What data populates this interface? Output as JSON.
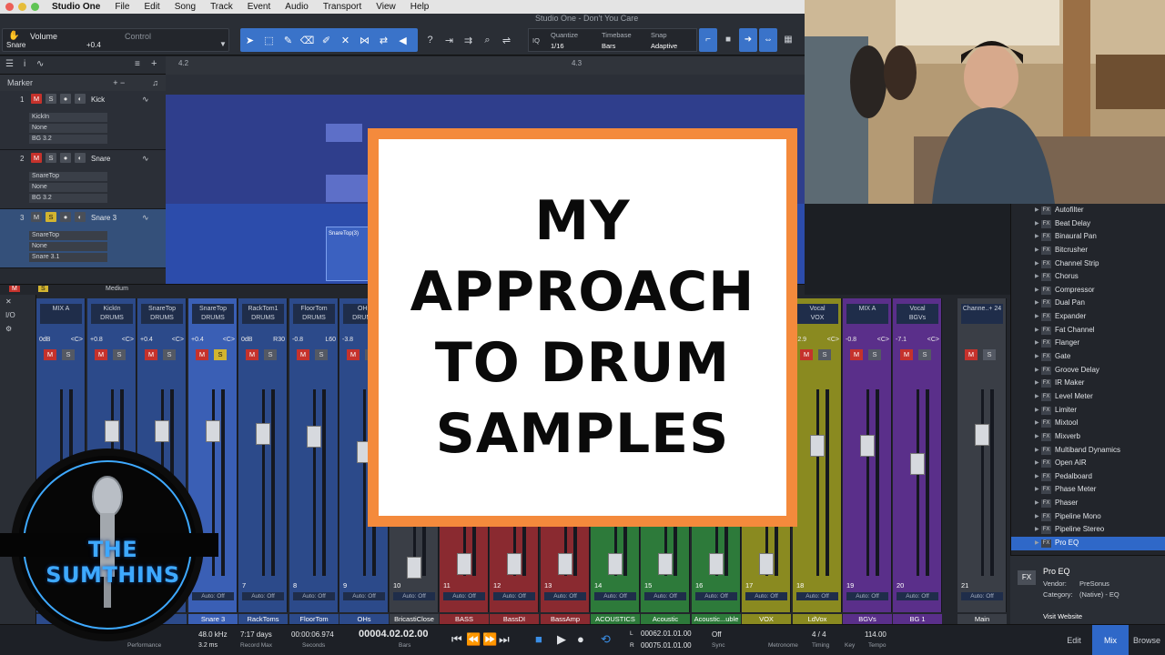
{
  "menubar": {
    "app": "Studio One",
    "items": [
      "File",
      "Edit",
      "Song",
      "Track",
      "Event",
      "Audio",
      "Transport",
      "View",
      "Help"
    ],
    "window_title": "Studio One - Don't You Care"
  },
  "toolbar": {
    "track_param": "Volume",
    "track_name": "Snare",
    "track_value": "+0.4",
    "control_label": "Control",
    "quantize_label": "Quantize",
    "quantize_value": "1/16",
    "timebase_label": "Timebase",
    "timebase_value": "Bars",
    "snap_label": "Snap",
    "snap_value": "Adaptive",
    "iq_label": "IQ"
  },
  "arrange": {
    "ruler_marks": [
      "4.2",
      "4.3"
    ],
    "marker_label": "Marker",
    "tracks": [
      {
        "num": "1",
        "name": "Kick",
        "input": "KickIn",
        "out": "None",
        "bus": "BG 3.2",
        "selected": false
      },
      {
        "num": "2",
        "name": "Snare",
        "input": "SnareTop",
        "out": "None",
        "bus": "BG 3.2",
        "selected": false
      },
      {
        "num": "3",
        "name": "Snare 3",
        "input": "SnareTop",
        "out": "None",
        "bus": "Snare 3.1",
        "selected": true
      }
    ],
    "clip_label": "SnareTop(3)",
    "size_label": "Medium"
  },
  "mixer": {
    "side": [
      "I/O"
    ],
    "strips": [
      {
        "top": "MIX A",
        "group": "",
        "vol": "0dB",
        "pan": "<C>",
        "num": "",
        "label": "",
        "color": "#2c4a8a"
      },
      {
        "top": "KickIn",
        "group": "DRUMS",
        "vol": "+0.8",
        "pan": "<C>",
        "num": "",
        "label": "",
        "color": "#2c4a8a"
      },
      {
        "top": "SnareTop",
        "group": "DRUMS",
        "vol": "+0.4",
        "pan": "<C>",
        "num": "",
        "label": "",
        "color": "#2c4a8a"
      },
      {
        "top": "SnareTop",
        "group": "DRUMS",
        "vol": "+0.4",
        "pan": "<C>",
        "num": "",
        "label": "Snare 3",
        "color": "#3a5fb5"
      },
      {
        "top": "RackTom1",
        "group": "DRUMS",
        "vol": "0dB",
        "pan": "R30",
        "num": "7",
        "label": "RackToms",
        "color": "#2c4a8a"
      },
      {
        "top": "FloorTom",
        "group": "DRUMS",
        "vol": "-0.8",
        "pan": "L60",
        "num": "8",
        "label": "FloorTom",
        "color": "#2c4a8a"
      },
      {
        "top": "OHs",
        "group": "DRUMS",
        "vol": "-3.8",
        "pan": "",
        "num": "9",
        "label": "OHs",
        "color": "#2c4a8a"
      },
      {
        "top": "",
        "group": "",
        "vol": "",
        "pan": "",
        "num": "10",
        "label": "BricastiClose",
        "color": "#3a3e46"
      },
      {
        "top": "",
        "group": "",
        "vol": "",
        "pan": "",
        "num": "11",
        "label": "BASS",
        "color": "#8a2a30"
      },
      {
        "top": "",
        "group": "",
        "vol": "",
        "pan": "",
        "num": "12",
        "label": "BassDI",
        "color": "#8a2a30"
      },
      {
        "top": "",
        "group": "",
        "vol": "",
        "pan": "",
        "num": "13",
        "label": "BassAmp",
        "color": "#8a2a30"
      },
      {
        "top": "",
        "group": "",
        "vol": "",
        "pan": "",
        "num": "14",
        "label": "ACOUSTICS",
        "color": "#2d7a3a"
      },
      {
        "top": "",
        "group": "",
        "vol": "",
        "pan": "",
        "num": "15",
        "label": "Acoustic",
        "color": "#2d7a3a"
      },
      {
        "top": "",
        "group": "",
        "vol": "",
        "pan": "",
        "num": "16",
        "label": "Acoustic...uble",
        "color": "#2d7a3a"
      },
      {
        "top": "",
        "group": "",
        "vol": "",
        "pan": "",
        "num": "17",
        "label": "VOX",
        "color": "#8a8a20"
      },
      {
        "top": "Vocal",
        "group": "VOX",
        "vol": "-2.9",
        "pan": "<C>",
        "num": "18",
        "label": "LdVox",
        "color": "#8a8a20"
      },
      {
        "top": "MIX A",
        "group": "",
        "vol": "-0.8",
        "pan": "<C>",
        "num": "19",
        "label": "BGVs",
        "color": "#5a2f8a"
      },
      {
        "top": "Vocal",
        "group": "BGVs",
        "vol": "-7.1",
        "pan": "<C>",
        "num": "20",
        "label": "BG 1",
        "color": "#5a2f8a"
      },
      {
        "top": "Channe..+ 24",
        "group": "",
        "vol": "",
        "pan": "",
        "num": "21",
        "label": "Main",
        "color": "#3a3e46"
      }
    ],
    "auto_label": "Auto: Off"
  },
  "browser": {
    "items": [
      "Autofilter",
      "Beat Delay",
      "Binaural Pan",
      "Bitcrusher",
      "Channel Strip",
      "Chorus",
      "Compressor",
      "Dual Pan",
      "Expander",
      "Fat Channel",
      "Flanger",
      "Gate",
      "Groove Delay",
      "IR Maker",
      "Level Meter",
      "Limiter",
      "Mixtool",
      "Mixverb",
      "Multiband Dynamics",
      "Open AIR",
      "Pedalboard",
      "Phase Meter",
      "Phaser",
      "Pipeline Mono",
      "Pipeline Stereo",
      "Pro EQ"
    ],
    "selected": "Pro EQ",
    "fx_tag": "FX",
    "info_name": "Pro EQ",
    "vendor_label": "Vendor:",
    "vendor_value": "PreSonus",
    "category_label": "Category:",
    "category_value": "(Native) - EQ",
    "visit": "Visit Website"
  },
  "transport": {
    "sample_rate": "48.0 kHz",
    "latency": "3.2 ms",
    "performance": "Performance",
    "record_max_value": "7:17 days",
    "record_max_label": "Record Max",
    "seconds_value": "00:00:06.974",
    "seconds_label": "Seconds",
    "bars_value": "00004.02.02.00",
    "bars_label": "Bars",
    "loop_l": "00062.01.01.00",
    "loop_r": "00075.01.01.00",
    "sync_value": "Off",
    "sync_label": "Sync",
    "metronome_label": "Metronome",
    "timing_value": "4 / 4",
    "timing_label": "Timing",
    "key_label": "Key",
    "tempo_value": "114.00",
    "tempo_label": "Tempo",
    "tabs": [
      "Edit",
      "Mix",
      "Browse"
    ],
    "active_tab": "Mix"
  },
  "overlay": {
    "title_lines": [
      "MY",
      "APPROACH",
      "TO DRUM",
      "SAMPLES"
    ],
    "logo_text": "THE SUMTHINS"
  },
  "colors": {
    "accent": "#3a73c9",
    "title_border": "#f48a3c",
    "logo_blue": "#3ea9ff"
  }
}
